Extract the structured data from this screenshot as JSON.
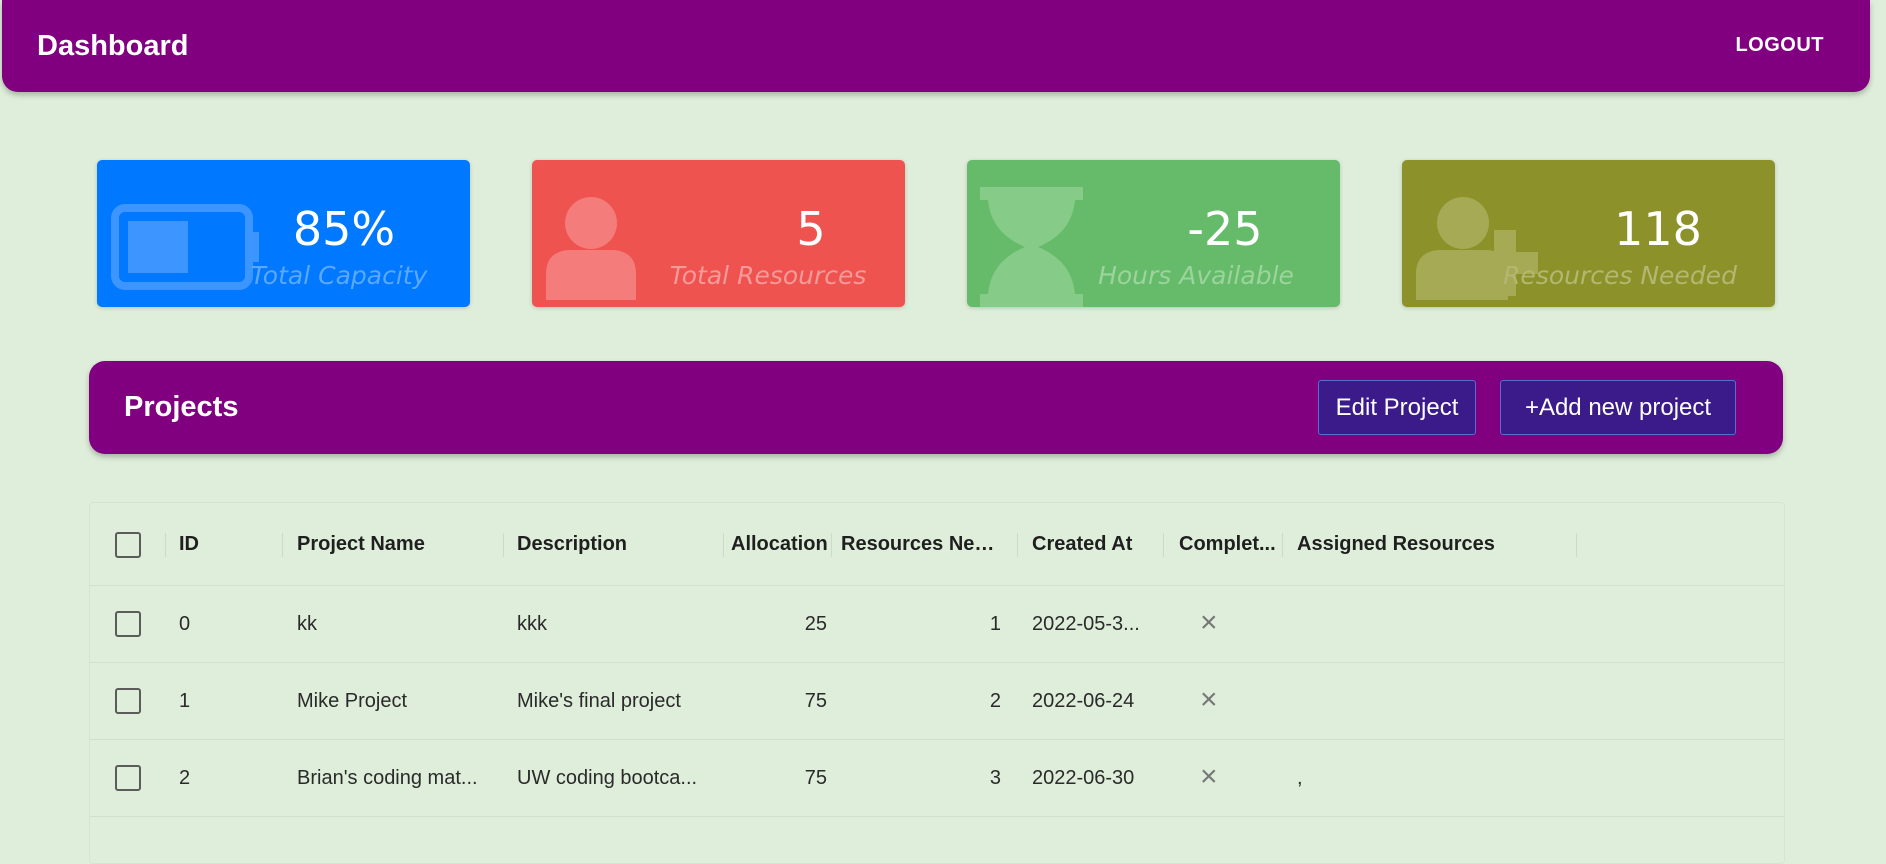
{
  "header": {
    "title": "Dashboard",
    "logout": "LOGOUT"
  },
  "cards": [
    {
      "value": "85%",
      "label": "Total Capacity",
      "icon": "battery-icon",
      "color": "#0078ff"
    },
    {
      "value": "5",
      "label": "Total Resources",
      "icon": "person-icon",
      "color": "#ef5350"
    },
    {
      "value": "-25",
      "label": "Hours Available",
      "icon": "hourglass-icon",
      "color": "#66bb6a"
    },
    {
      "value": "118",
      "label": "Resources Needed",
      "icon": "add-person-icon",
      "color": "#8c9229"
    }
  ],
  "projects": {
    "title": "Projects",
    "edit_label": "Edit Project",
    "add_label": "+Add new project"
  },
  "table": {
    "columns": [
      "ID",
      "Project Name",
      "Description",
      "Allocation",
      "Resources Nee...",
      "Created At",
      "Complet...",
      "Assigned Resources"
    ],
    "rows": [
      {
        "id": "0",
        "name": "kk",
        "description": "kkk",
        "allocation": "25",
        "resources": "1",
        "created": "2022-05-3...",
        "completed": "×",
        "assigned": ""
      },
      {
        "id": "1",
        "name": "Mike Project",
        "description": "Mike's final project",
        "allocation": "75",
        "resources": "2",
        "created": "2022-06-24",
        "completed": "×",
        "assigned": ""
      },
      {
        "id": "2",
        "name": "Brian's coding mat...",
        "description": "UW coding bootca...",
        "allocation": "75",
        "resources": "3",
        "created": "2022-06-30",
        "completed": "×",
        "assigned": ","
      }
    ]
  }
}
